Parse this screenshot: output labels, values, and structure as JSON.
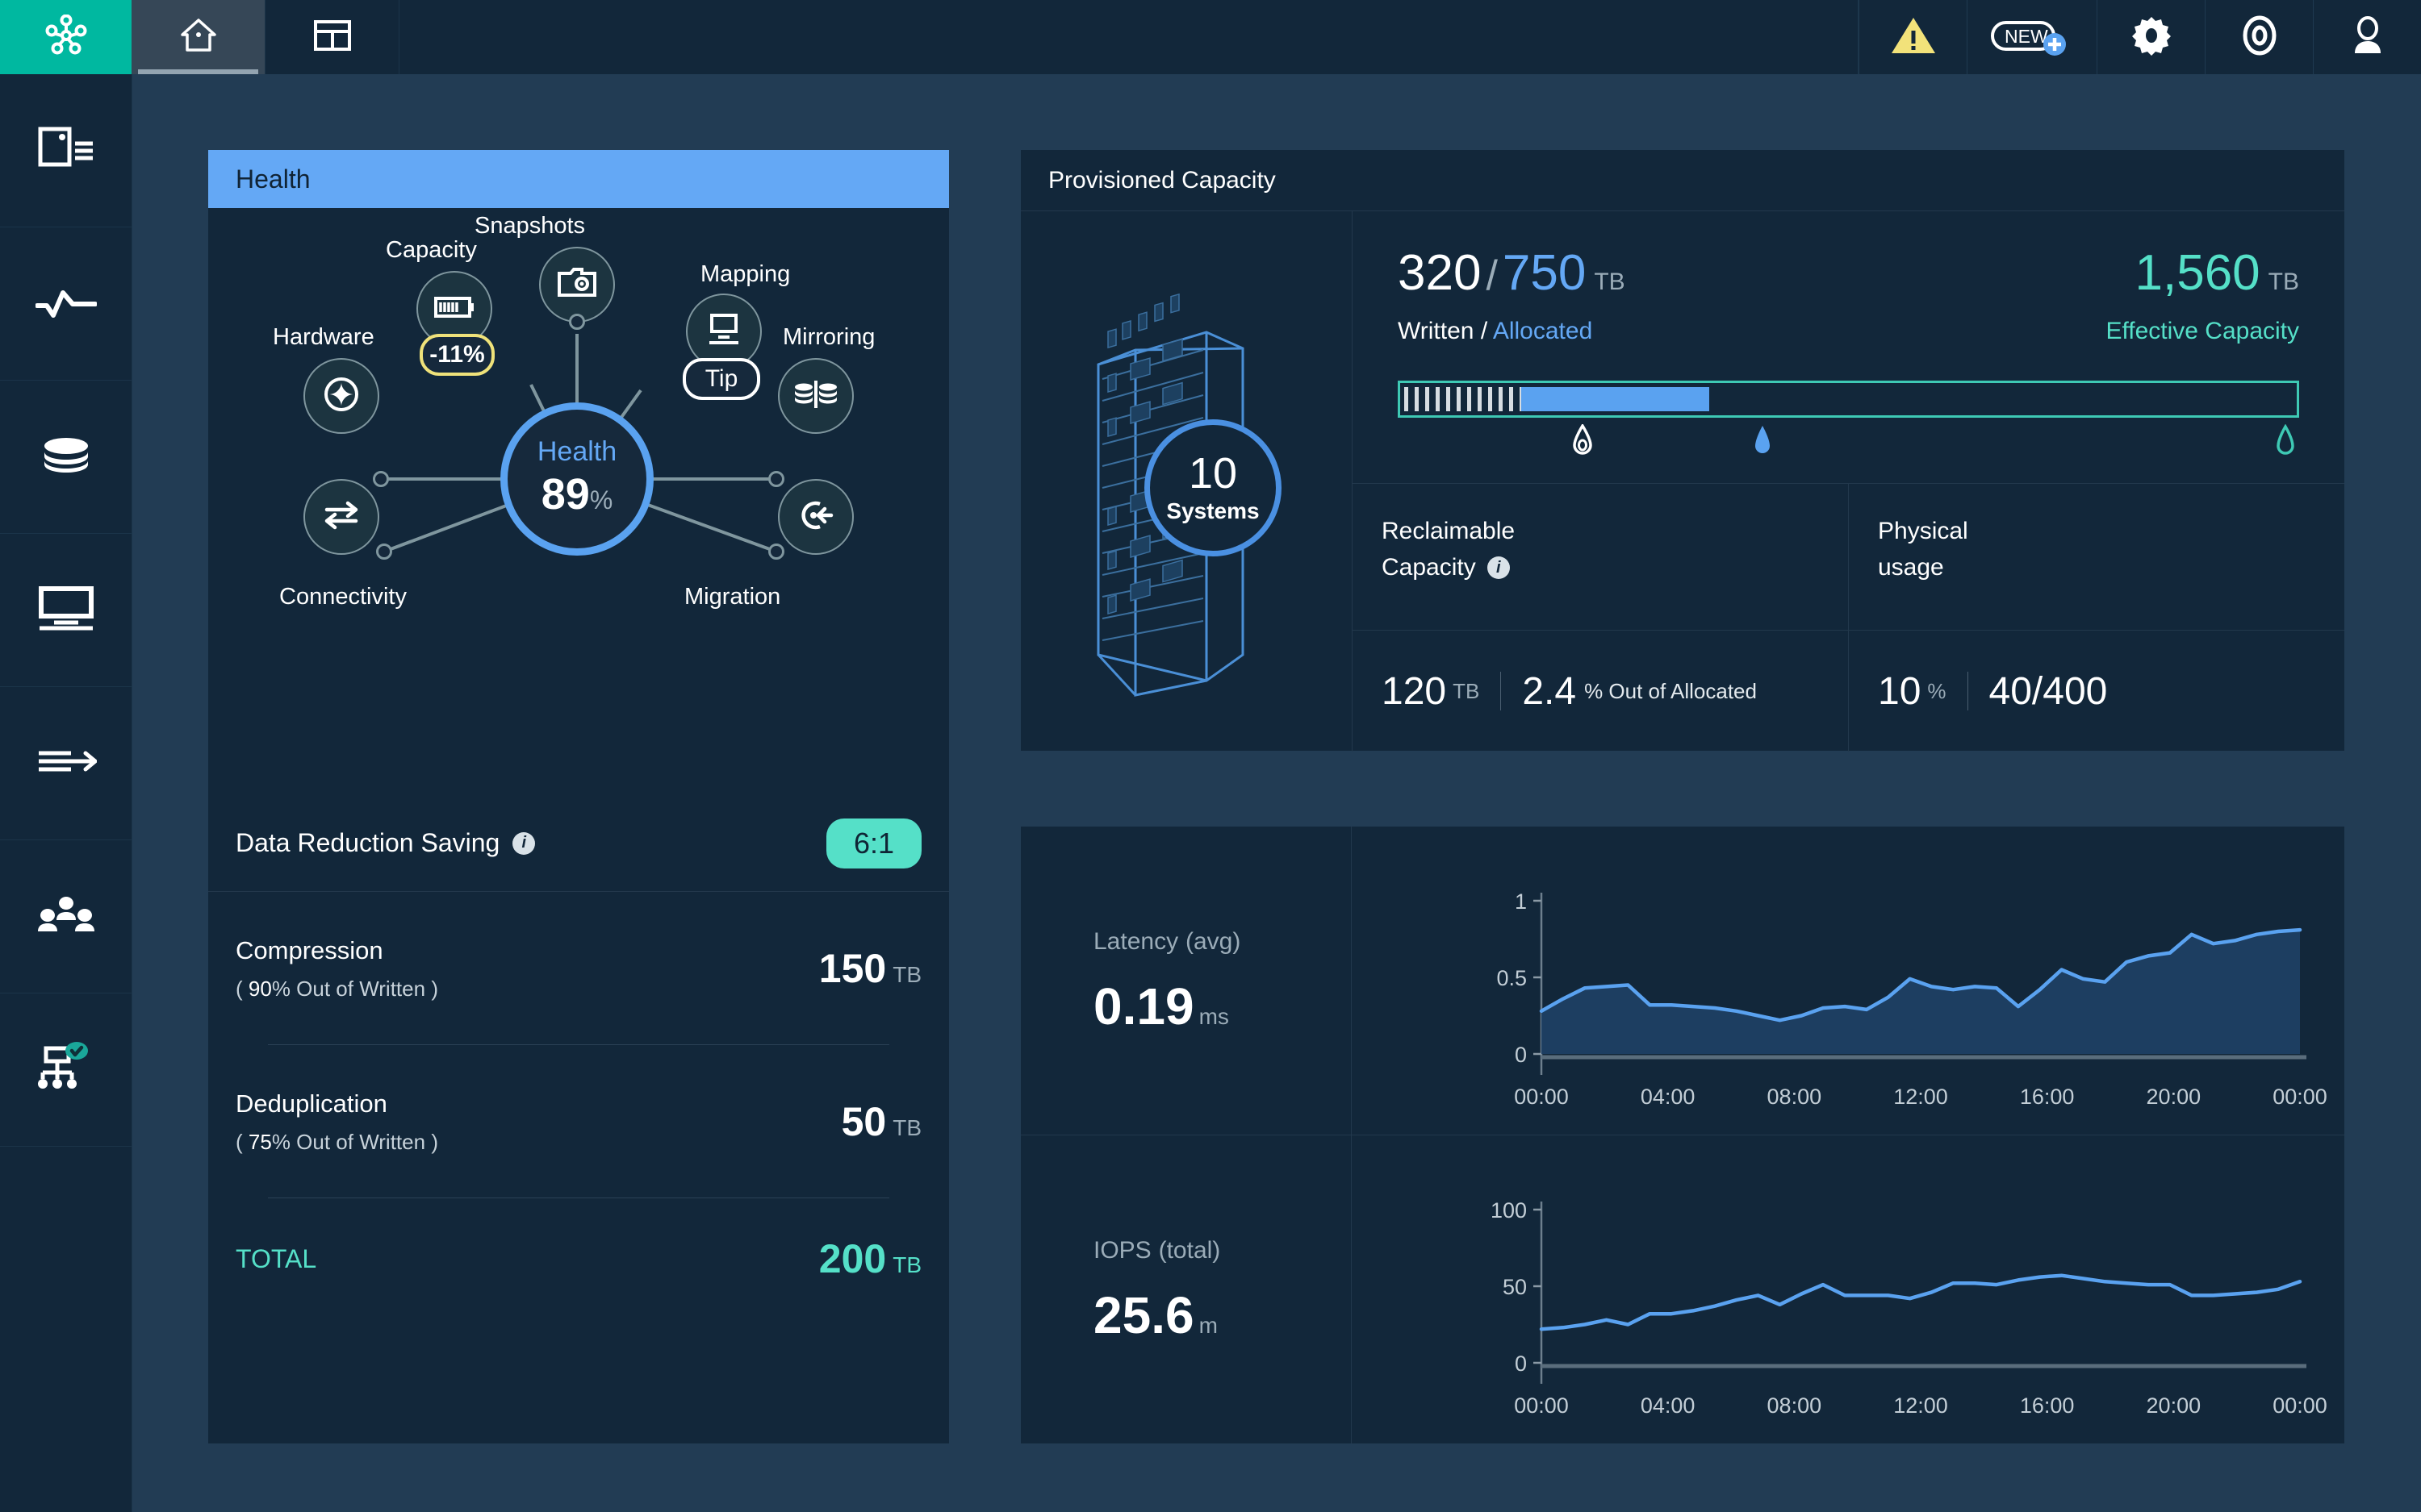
{
  "app": {
    "brand_icon": "hub-nodes-icon",
    "topbar": {
      "tabs": [
        {
          "name": "home",
          "icon": "home-icon",
          "active": true
        },
        {
          "name": "dashboard",
          "icon": "grid-layout-icon",
          "active": false
        }
      ],
      "actions": [
        {
          "name": "alerts",
          "icon": "warning-triangle-icon",
          "label": ""
        },
        {
          "name": "new",
          "icon": "new-plus-icon",
          "label": "NEW"
        },
        {
          "name": "settings",
          "icon": "gear-icon",
          "label": ""
        },
        {
          "name": "support",
          "icon": "lifebuoy-icon",
          "label": ""
        },
        {
          "name": "user",
          "icon": "user-avatar-icon",
          "label": ""
        }
      ]
    },
    "sidebar": {
      "items": [
        {
          "name": "systems",
          "icon": "system-list-icon"
        },
        {
          "name": "performance",
          "icon": "activity-line-icon"
        },
        {
          "name": "pools",
          "icon": "database-stack-icon"
        },
        {
          "name": "hosts",
          "icon": "monitor-icon"
        },
        {
          "name": "migration",
          "icon": "arrow-lines-icon"
        },
        {
          "name": "users",
          "icon": "users-group-icon"
        },
        {
          "name": "topology",
          "icon": "topology-check-icon",
          "badge": "check"
        }
      ]
    }
  },
  "health": {
    "title": "Health",
    "center": {
      "label": "Health",
      "value": "89",
      "unit": "%"
    },
    "nodes": [
      {
        "name": "snapshots",
        "label": "Snapshots",
        "icon": "camera-icon"
      },
      {
        "name": "capacity",
        "label": "Capacity",
        "icon": "battery-icon",
        "badge": "-11%",
        "badge_type": "warning"
      },
      {
        "name": "mapping",
        "label": "Mapping",
        "icon": "monitor-icon",
        "badge": "Tip",
        "badge_type": "tip"
      },
      {
        "name": "hardware",
        "label": "Hardware",
        "icon": "sparkle-icon"
      },
      {
        "name": "mirroring",
        "label": "Mirroring",
        "icon": "mirror-database-icon"
      },
      {
        "name": "connectivity",
        "label": "Connectivity",
        "icon": "swap-arrows-icon"
      },
      {
        "name": "migration",
        "label": "Migration",
        "icon": "migration-target-icon"
      }
    ],
    "data_reduction": {
      "label": "Data Reduction Saving",
      "info_icon": "info-icon",
      "ratio": "6:1",
      "rows": [
        {
          "name": "Compression",
          "sub_open": "(",
          "sub_pct": "90",
          "sub_text": "% Out of Written",
          "sub_close": ")",
          "value": "150",
          "unit": "TB"
        },
        {
          "name": "Deduplication",
          "sub_open": "(",
          "sub_pct": "75",
          "sub_text": "% Out of Written",
          "sub_close": ")",
          "value": "50",
          "unit": "TB"
        }
      ],
      "total": {
        "label": "TOTAL",
        "value": "200",
        "unit": "TB"
      }
    }
  },
  "provisioned_capacity": {
    "title": "Provisioned Capacity",
    "systems": {
      "count": "10",
      "label": "Systems",
      "icon": "datacenter-tower-icon"
    },
    "written": "320",
    "slash": "/",
    "allocated": "750",
    "unit": "TB",
    "written_allocated_label_a": "Written",
    "written_allocated_label_sep": "/",
    "written_allocated_label_b": "Allocated",
    "effective_value": "1,560",
    "effective_unit": "TB",
    "effective_label": "Effective Capacity",
    "bar": {
      "hatch_pct": 13.5,
      "fill_start_pct": 13.5,
      "fill_end_pct": 34.5,
      "markers": [
        {
          "name": "written-marker",
          "icon": "drop-outline-icon",
          "pos_pct": 20.5,
          "color": "#ffffff"
        },
        {
          "name": "allocated-marker",
          "icon": "drop-solid-icon",
          "pos_pct": 40.5,
          "color": "#5aa2f0"
        },
        {
          "name": "effective-marker",
          "icon": "drop-teal-icon",
          "pos_pct": 98.5,
          "color": "#3ec9b4"
        }
      ]
    },
    "cells": [
      {
        "name": "reclaimable-capacity",
        "title_line1": "Reclaimable",
        "title_line2": "Capacity",
        "info_icon": "info-icon",
        "value": "120",
        "unit": "TB",
        "secondary": "2.4",
        "secondary_suffix": "% Out of Allocated"
      },
      {
        "name": "physical-usage",
        "title_line1": "Physical",
        "title_line2": "usage",
        "value": "10",
        "unit": "%",
        "secondary": "40/400",
        "secondary_suffix": ""
      }
    ]
  },
  "chart_data": [
    {
      "name": "latency-chart",
      "type": "area",
      "title": "Latency",
      "title_suffix": "(avg)",
      "current_value": "0.19",
      "current_unit": "ms",
      "ylabel": "",
      "xlabel": "",
      "ylim": [
        0,
        1
      ],
      "ytick_labels": [
        "1",
        "0.5",
        "0"
      ],
      "yticks": [
        1,
        0.5,
        0
      ],
      "xtick_labels": [
        "00:00",
        "04:00",
        "08:00",
        "12:00",
        "16:00",
        "20:00",
        "00:00"
      ],
      "grid": false,
      "legend": "none",
      "line_color": "#5aa2f0",
      "fill_color": "#1f3f63",
      "x": [
        0,
        1,
        2,
        3,
        4,
        5,
        6,
        7,
        8,
        9,
        10,
        11,
        12,
        13,
        14,
        15,
        16,
        17,
        18,
        19,
        20,
        21,
        22,
        23,
        24,
        25,
        26,
        27,
        28,
        29,
        30,
        31,
        32,
        33,
        34,
        35
      ],
      "values": [
        0.28,
        0.36,
        0.43,
        0.44,
        0.45,
        0.32,
        0.32,
        0.31,
        0.3,
        0.28,
        0.25,
        0.22,
        0.25,
        0.3,
        0.31,
        0.29,
        0.37,
        0.49,
        0.44,
        0.42,
        0.44,
        0.43,
        0.31,
        0.42,
        0.55,
        0.49,
        0.47,
        0.6,
        0.64,
        0.66,
        0.78,
        0.72,
        0.74,
        0.78,
        0.8,
        0.81
      ]
    },
    {
      "name": "iops-chart",
      "type": "line",
      "title": "IOPS",
      "title_suffix": "(total)",
      "current_value": "25.6",
      "current_unit": "m",
      "ylabel": "",
      "xlabel": "",
      "ylim": [
        0,
        100
      ],
      "ytick_labels": [
        "100",
        "50",
        "0"
      ],
      "yticks": [
        100,
        50,
        0
      ],
      "xtick_labels": [
        "00:00",
        "04:00",
        "08:00",
        "12:00",
        "16:00",
        "20:00",
        "00:00"
      ],
      "grid": false,
      "legend": "none",
      "line_color": "#5aa2f0",
      "fill_color": "none",
      "x": [
        0,
        1,
        2,
        3,
        4,
        5,
        6,
        7,
        8,
        9,
        10,
        11,
        12,
        13,
        14,
        15,
        16,
        17,
        18,
        19,
        20,
        21,
        22,
        23,
        24,
        25,
        26,
        27,
        28,
        29,
        30,
        31,
        32,
        33,
        34,
        35
      ],
      "values": [
        22,
        23,
        25,
        28,
        25,
        32,
        32,
        34,
        37,
        41,
        44,
        38,
        45,
        51,
        44,
        44,
        44,
        42,
        46,
        52,
        52,
        51,
        54,
        56,
        57,
        55,
        53,
        52,
        51,
        51,
        44,
        44,
        45,
        46,
        48,
        53
      ]
    }
  ]
}
